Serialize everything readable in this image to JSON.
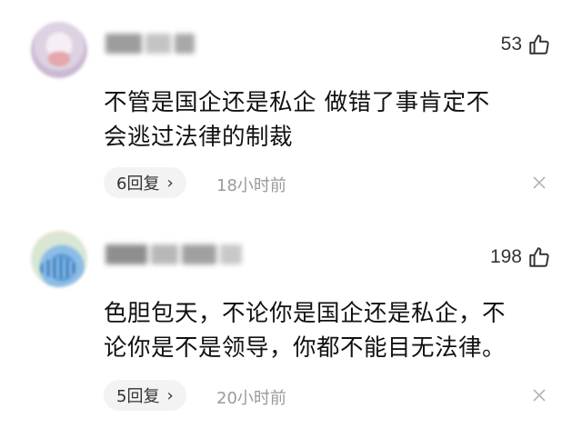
{
  "comments": [
    {
      "likes": "53",
      "content_lines": [
        "不管是国企还是私企 做错了事肯定不",
        "会逃过法律的制裁"
      ],
      "reply_label": "6回复",
      "reply_chevron": "›",
      "time": "18小时前"
    },
    {
      "likes": "198",
      "content_lines": [
        "色胆包天，不论你是国企还是私企，不",
        "论你是不是领导，你都不能目无法律。"
      ],
      "reply_label": "5回复",
      "reply_chevron": "›",
      "time": "20小时前"
    }
  ],
  "icons": {
    "like": "thumbs-up-icon",
    "close": "close-icon"
  }
}
